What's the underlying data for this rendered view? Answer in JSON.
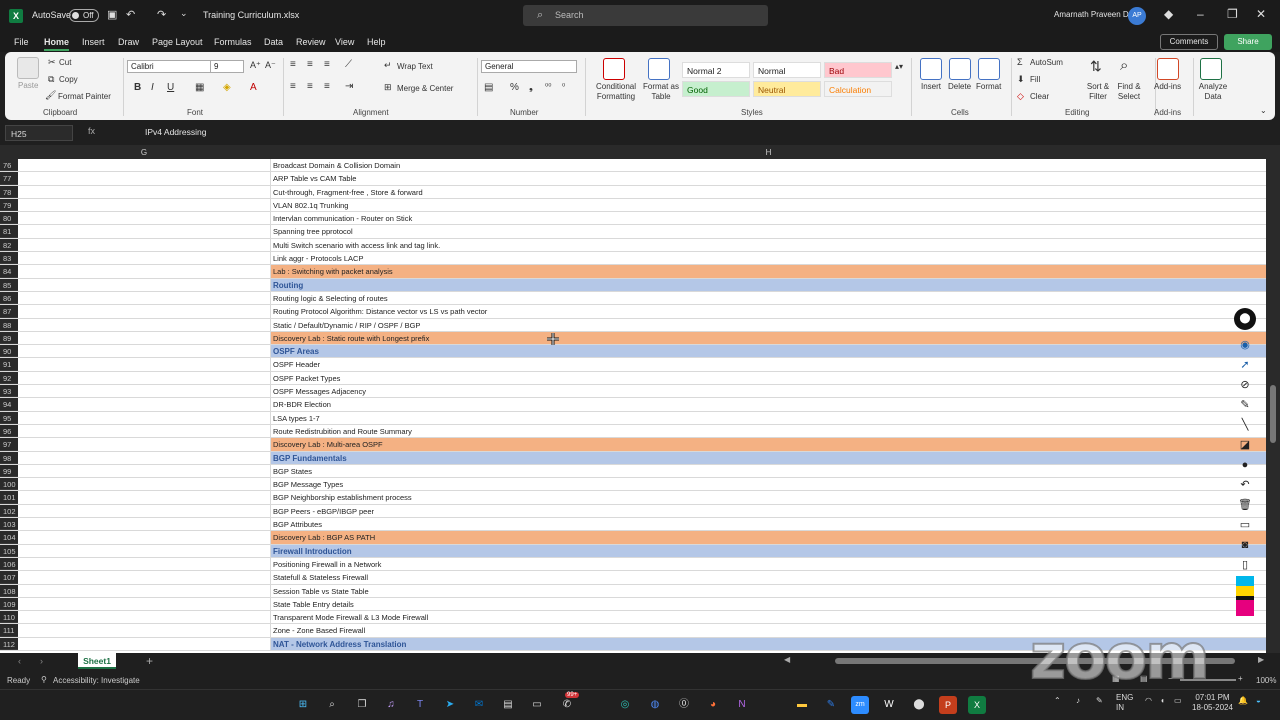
{
  "titlebar": {
    "autosave_label": "AutoSave",
    "autosave_state": "Off",
    "filename": "Training Curriculum.xlsx",
    "search_placeholder": "Search",
    "user_name": "Amarnath Praveen D",
    "user_initials": "AP"
  },
  "menu": {
    "tabs": [
      "File",
      "Home",
      "Insert",
      "Draw",
      "Page Layout",
      "Formulas",
      "Data",
      "Review",
      "View",
      "Help"
    ],
    "active": "Home",
    "comments": "Comments",
    "share": "Share"
  },
  "ribbon": {
    "clipboard": {
      "paste": "Paste",
      "cut": "Cut",
      "copy": "Copy",
      "format_painter": "Format Painter",
      "label": "Clipboard"
    },
    "font": {
      "name": "Calibri",
      "size": "9",
      "label": "Font",
      "bold": "B",
      "italic": "I",
      "underline": "U"
    },
    "alignment": {
      "wrap": "Wrap Text",
      "merge": "Merge & Center",
      "label": "Alignment"
    },
    "number": {
      "format": "General",
      "label": "Number"
    },
    "styles": {
      "conditional": "Conditional Formatting",
      "format_as_table": "Format as Table",
      "cells": [
        {
          "text": "Normal 2",
          "bg": "#ffffff",
          "fg": "#222222"
        },
        {
          "text": "Normal",
          "bg": "#ffffff",
          "fg": "#222222"
        },
        {
          "text": "Bad",
          "bg": "#ffc7ce",
          "fg": "#9c0006"
        },
        {
          "text": "Good",
          "bg": "#c6efce",
          "fg": "#006100"
        },
        {
          "text": "Neutral",
          "bg": "#ffeb9c",
          "fg": "#9c5700"
        },
        {
          "text": "Calculation",
          "bg": "#f2f2f2",
          "fg": "#fa7d00"
        }
      ],
      "label": "Styles"
    },
    "cells_group": {
      "insert": "Insert",
      "delete": "Delete",
      "format": "Format",
      "label": "Cells"
    },
    "editing": {
      "autosum": "AutoSum",
      "fill": "Fill",
      "clear": "Clear",
      "sort": "Sort & Filter",
      "find": "Find & Select",
      "label": "Editing"
    },
    "addins": {
      "addins": "Add-ins",
      "label": "Add-ins"
    },
    "analyze": {
      "label": "Analyze Data"
    }
  },
  "formula": {
    "cell_ref": "H25",
    "fx": "fx",
    "value": "IPv4 Addressing"
  },
  "grid": {
    "col_g": "G",
    "col_h": "H",
    "rows": [
      {
        "n": "76",
        "t": "Broadcast Domain & Collision Domain",
        "k": "n"
      },
      {
        "n": "77",
        "t": "ARP Table vs CAM Table",
        "k": "n"
      },
      {
        "n": "78",
        "t": "Cut-through, Fragment-free , Store & forward",
        "k": "n"
      },
      {
        "n": "79",
        "t": "VLAN 802.1q Trunking",
        "k": "n"
      },
      {
        "n": "80",
        "t": "Intervlan communication - Router on Stick",
        "k": "n"
      },
      {
        "n": "81",
        "t": "Spanning tree pprotocol",
        "k": "n"
      },
      {
        "n": "82",
        "t": "Multi Switch scenario with access link and tag link.",
        "k": "n"
      },
      {
        "n": "83",
        "t": "Link aggr - Protocols LACP",
        "k": "n"
      },
      {
        "n": "84",
        "t": "Lab : Switching with packet analysis",
        "k": "lab"
      },
      {
        "n": "85",
        "t": "Routing",
        "k": "head"
      },
      {
        "n": "86",
        "t": "Routing logic & Selecting of routes",
        "k": "n"
      },
      {
        "n": "87",
        "t": "Routing Protocol Algorithm: Distance vector vs LS vs path vector",
        "k": "n"
      },
      {
        "n": "88",
        "t": "Static / Default/Dynamic / RIP / OSPF / BGP",
        "k": "n"
      },
      {
        "n": "89",
        "t": "Discovery Lab : Static route with Longest prefix",
        "k": "lab"
      },
      {
        "n": "90",
        "t": "OSPF Areas",
        "k": "head"
      },
      {
        "n": "91",
        "t": "OSPF Header",
        "k": "n"
      },
      {
        "n": "92",
        "t": "OSPF Packet Types",
        "k": "n"
      },
      {
        "n": "93",
        "t": "OSPF Messages Adjacency",
        "k": "n"
      },
      {
        "n": "94",
        "t": "DR-BDR Election",
        "k": "n"
      },
      {
        "n": "95",
        "t": "LSA types 1-7",
        "k": "n"
      },
      {
        "n": "96",
        "t": "Route Redistrubition and Route Summary",
        "k": "n"
      },
      {
        "n": "97",
        "t": "Discovery Lab : Multi-area OSPF",
        "k": "lab"
      },
      {
        "n": "98",
        "t": "BGP Fundamentals",
        "k": "head"
      },
      {
        "n": "99",
        "t": "BGP States",
        "k": "n"
      },
      {
        "n": "100",
        "t": "BGP Message Types",
        "k": "n"
      },
      {
        "n": "101",
        "t": "BGP Neighborship establishment process",
        "k": "n"
      },
      {
        "n": "102",
        "t": "BGP Peers - eBGP/IBGP peer",
        "k": "n"
      },
      {
        "n": "103",
        "t": "BGP Attributes",
        "k": "n"
      },
      {
        "n": "104",
        "t": "Discovery Lab : BGP AS PATH",
        "k": "lab"
      },
      {
        "n": "105",
        "t": "Firewall Introduction",
        "k": "head"
      },
      {
        "n": "106",
        "t": "Positioning Firewall in a Network",
        "k": "n"
      },
      {
        "n": "107",
        "t": "Statefull & Stateless Firewall",
        "k": "n"
      },
      {
        "n": "108",
        "t": "Session Table vs State Table",
        "k": "n"
      },
      {
        "n": "109",
        "t": "State Table Entry details",
        "k": "n"
      },
      {
        "n": "110",
        "t": "Transparent Mode Firewall & L3 Mode Firewall",
        "k": "n"
      },
      {
        "n": "111",
        "t": "Zone - Zone Based Firewall",
        "k": "n"
      },
      {
        "n": "112",
        "t": "NAT - Network Address Translation",
        "k": "head"
      }
    ]
  },
  "sheets": {
    "active": "Sheet1"
  },
  "status": {
    "ready": "Ready",
    "accessibility": "Accessibility: Investigate",
    "zoom": "100%"
  },
  "watermark": "zoom",
  "taskbar": {
    "time": "07:01 PM",
    "date": "18-05-2024",
    "lang": "ENG",
    "region": "IN",
    "badge": "99+"
  }
}
